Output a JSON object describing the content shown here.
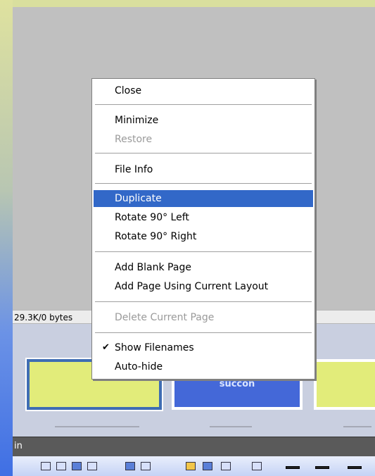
{
  "status": {
    "size_text": "29.3K/0 bytes"
  },
  "thumbnails": [
    {
      "caption": ""
    },
    {
      "caption": "succon"
    },
    {
      "caption": ""
    }
  ],
  "window": {
    "title_fragment": "in"
  },
  "context_menu": {
    "items": [
      {
        "label": "Close",
        "state": "normal"
      },
      {
        "label": "Minimize",
        "state": "normal"
      },
      {
        "label": "Restore",
        "state": "disabled"
      },
      {
        "label": "File Info",
        "state": "normal"
      },
      {
        "label": "Duplicate",
        "state": "highlighted"
      },
      {
        "label": "Rotate 90° Left",
        "state": "normal"
      },
      {
        "label": "Rotate 90° Right",
        "state": "normal"
      },
      {
        "label": "Add Blank Page",
        "state": "normal"
      },
      {
        "label": "Add Page Using Current Layout",
        "state": "normal"
      },
      {
        "label": "Delete Current Page",
        "state": "disabled"
      },
      {
        "label": "Show Filenames",
        "state": "checked"
      },
      {
        "label": "Auto-hide",
        "state": "normal"
      }
    ]
  },
  "colors": {
    "highlight": "#3268c8",
    "canvas": "#c0c0c0",
    "selected_thumb_border": "#3f6db3"
  }
}
